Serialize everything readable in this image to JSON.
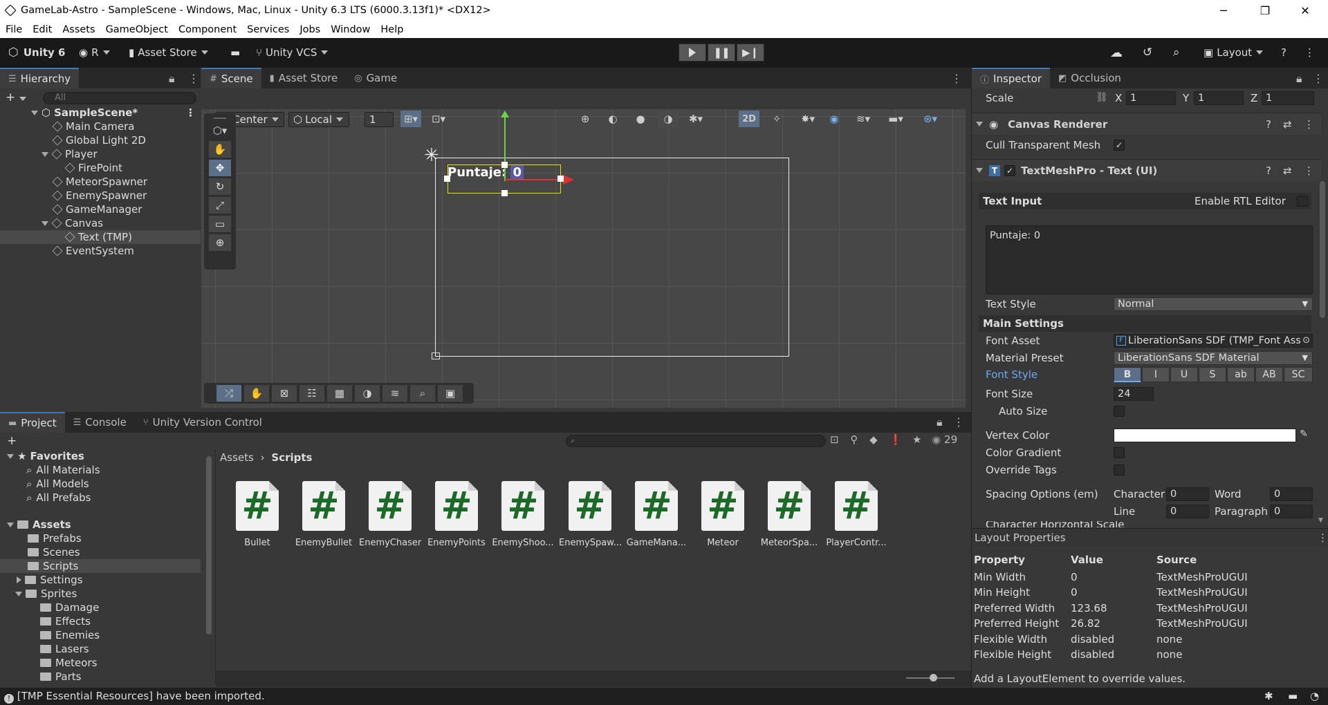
{
  "window": {
    "title": "GameLab-Astro - SampleScene - Windows, Mac, Linux - Unity 6.3 LTS (6000.3.13f1)* <DX12>",
    "minimize": "─",
    "restore": "❐",
    "close": "✕"
  },
  "menu": [
    "File",
    "Edit",
    "Assets",
    "GameObject",
    "Component",
    "Services",
    "Jobs",
    "Window",
    "Help"
  ],
  "toolbar": {
    "unity_label": "Unity 6",
    "account_label": "R",
    "asset_store_label": "Asset Store",
    "vcs_label": "Unity VCS",
    "layout_label": "Layout"
  },
  "hierarchy": {
    "tab": "Hierarchy",
    "search_placeholder": "All",
    "rows": [
      {
        "label": "SampleScene*",
        "depth": 0
      },
      {
        "label": "Main Camera",
        "depth": 1
      },
      {
        "label": "Global Light 2D",
        "depth": 1
      },
      {
        "label": "Player",
        "depth": 1
      },
      {
        "label": "FirePoint",
        "depth": 2
      },
      {
        "label": "MeteorSpawner",
        "depth": 1
      },
      {
        "label": "EnemySpawner",
        "depth": 1
      },
      {
        "label": "GameManager",
        "depth": 1
      },
      {
        "label": "Canvas",
        "depth": 1
      },
      {
        "label": "Text (TMP)",
        "depth": 2
      },
      {
        "label": "EventSystem",
        "depth": 1
      }
    ]
  },
  "scene": {
    "tabs": [
      "Scene",
      "Asset Store",
      "Game"
    ],
    "pivot": "Center",
    "space": "Local",
    "grid_value": "1",
    "mode_2d": "2D",
    "text_label": "Puntaje:",
    "text_value": "0"
  },
  "project": {
    "tabs": [
      "Project",
      "Console",
      "Unity Version Control"
    ],
    "count": "29",
    "favorites": "Favorites",
    "fav_items": [
      "All Materials",
      "All Models",
      "All Prefabs"
    ],
    "assets_root": "Assets",
    "folders": [
      {
        "label": "Prefabs",
        "depth": 1,
        "arrow": false
      },
      {
        "label": "Scenes",
        "depth": 1,
        "arrow": false
      },
      {
        "label": "Scripts",
        "depth": 1,
        "arrow": false,
        "selected": true
      },
      {
        "label": "Settings",
        "depth": 1,
        "arrow": true
      },
      {
        "label": "Sprites",
        "depth": 1,
        "arrow": "down"
      },
      {
        "label": "Damage",
        "depth": 2
      },
      {
        "label": "Effects",
        "depth": 2
      },
      {
        "label": "Enemies",
        "depth": 2
      },
      {
        "label": "Lasers",
        "depth": 2
      },
      {
        "label": "Meteors",
        "depth": 2
      },
      {
        "label": "Parts",
        "depth": 2
      }
    ],
    "breadcrumb": [
      "Assets",
      "Scripts"
    ],
    "assets": [
      "Bullet",
      "EnemyBullet",
      "EnemyChaser",
      "EnemyPoints",
      "EnemyShoo...",
      "EnemySpaw...",
      "GameMana...",
      "Meteor",
      "MeteorSpa...",
      "PlayerContr..."
    ]
  },
  "inspector": {
    "tabs": [
      "Inspector",
      "Occlusion"
    ],
    "scale_label": "Scale",
    "scale": {
      "x": "1",
      "y": "1",
      "z": "1"
    },
    "canvas_renderer": "Canvas Renderer",
    "cull_label": "Cull Transparent Mesh",
    "tmp_component": "TextMeshPro - Text (UI)",
    "text_input_label": "Text Input",
    "rtl_label": "Enable RTL Editor",
    "text_value": "Puntaje: 0",
    "text_style_label": "Text Style",
    "text_style_value": "Normal",
    "main_settings": "Main Settings",
    "font_asset_label": "Font Asset",
    "font_asset_value": "LiberationSans SDF (TMP_Font Ass",
    "material_label": "Material Preset",
    "material_value": "LiberationSans SDF Material",
    "font_style_label": "Font Style",
    "font_style_buttons": [
      "B",
      "I",
      "U",
      "S",
      "ab",
      "AB",
      "SC"
    ],
    "font_size_label": "Font Size",
    "font_size_value": "24",
    "auto_size_label": "Auto Size",
    "vertex_color_label": "Vertex Color",
    "color_gradient_label": "Color Gradient",
    "override_tags_label": "Override Tags",
    "spacing_label": "Spacing Options (em)",
    "character_label": "Character",
    "character_value": "0",
    "word_label": "Word",
    "word_value": "0",
    "line_label": "Line",
    "line_value": "0",
    "paragraph_label": "Paragraph",
    "paragraph_value": "0",
    "cut_label": "Character Horizontal Scale"
  },
  "layout_props": {
    "title": "Layout Properties",
    "headers": [
      "Property",
      "Value",
      "Source"
    ],
    "rows": [
      [
        "Min Width",
        "0",
        "TextMeshProUGUI"
      ],
      [
        "Min Height",
        "0",
        "TextMeshProUGUI"
      ],
      [
        "Preferred Width",
        "123.68",
        "TextMeshProUGUI"
      ],
      [
        "Preferred Height",
        "26.82",
        "TextMeshProUGUI"
      ],
      [
        "Flexible Width",
        "disabled",
        "none"
      ],
      [
        "Flexible Height",
        "disabled",
        "none"
      ]
    ],
    "footer": "Add a LayoutElement to override values."
  },
  "status": "[TMP Essential Resources] have been imported.",
  "colors": {
    "accent": "#3a79bb",
    "script_hash": "#1b6a28",
    "selection_yellow": "#e5e000"
  }
}
